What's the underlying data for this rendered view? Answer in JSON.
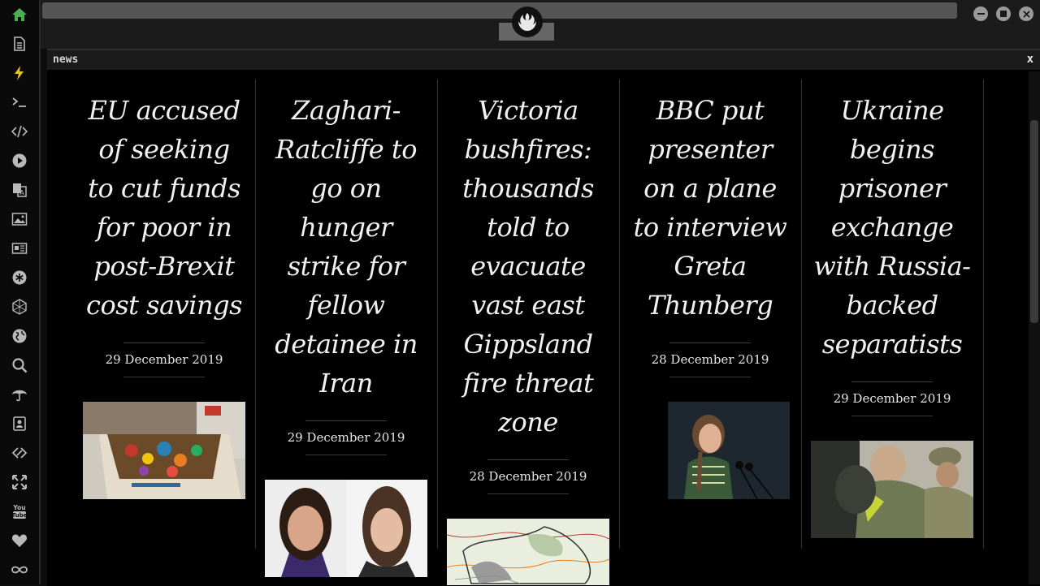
{
  "panel": {
    "title": "news",
    "close_label": "x"
  },
  "sidebar": {
    "icons": [
      "home-icon",
      "document-icon",
      "lightning-icon",
      "terminal-icon",
      "code-icon",
      "play-icon",
      "translate-icon",
      "image-icon",
      "newspaper-icon",
      "asterisk-icon",
      "hexagon-icon",
      "globe-icon",
      "search-icon",
      "umbrella-icon",
      "contacts-icon",
      "link-icon",
      "fullscreen-icon",
      "youtube-icon",
      "heart-icon",
      "infinity-icon"
    ],
    "youtube_text": "You Tube"
  },
  "articles": [
    {
      "headline": "EU accused of seeking to cut funds for poor in post-Brexit cost savings",
      "date": "29 December 2019",
      "image": "food-donation-box-photo"
    },
    {
      "headline": "Zaghari-Ratcliffe to go on hunger strike for fellow detainee in Iran",
      "date": "29 December 2019",
      "image": "two-women-portrait-photo"
    },
    {
      "headline": "Victoria bushfires: thousands told to evacuate vast east Gippsland fire threat zone",
      "date": "28 December 2019",
      "image": "fire-zone-map"
    },
    {
      "headline": "BBC put presenter on a plane to interview Greta Thunberg",
      "date": "28 December 2019",
      "image": "greta-thunberg-photo"
    },
    {
      "headline": "Ukraine begins prisoner exchange with Russia-backed separatists",
      "date": "29 December 2019",
      "image": "prisoner-exchange-photo"
    }
  ],
  "colors": {
    "sidebar_active": "#4caf50",
    "lightning": "#e6c229",
    "background": "#000000"
  }
}
